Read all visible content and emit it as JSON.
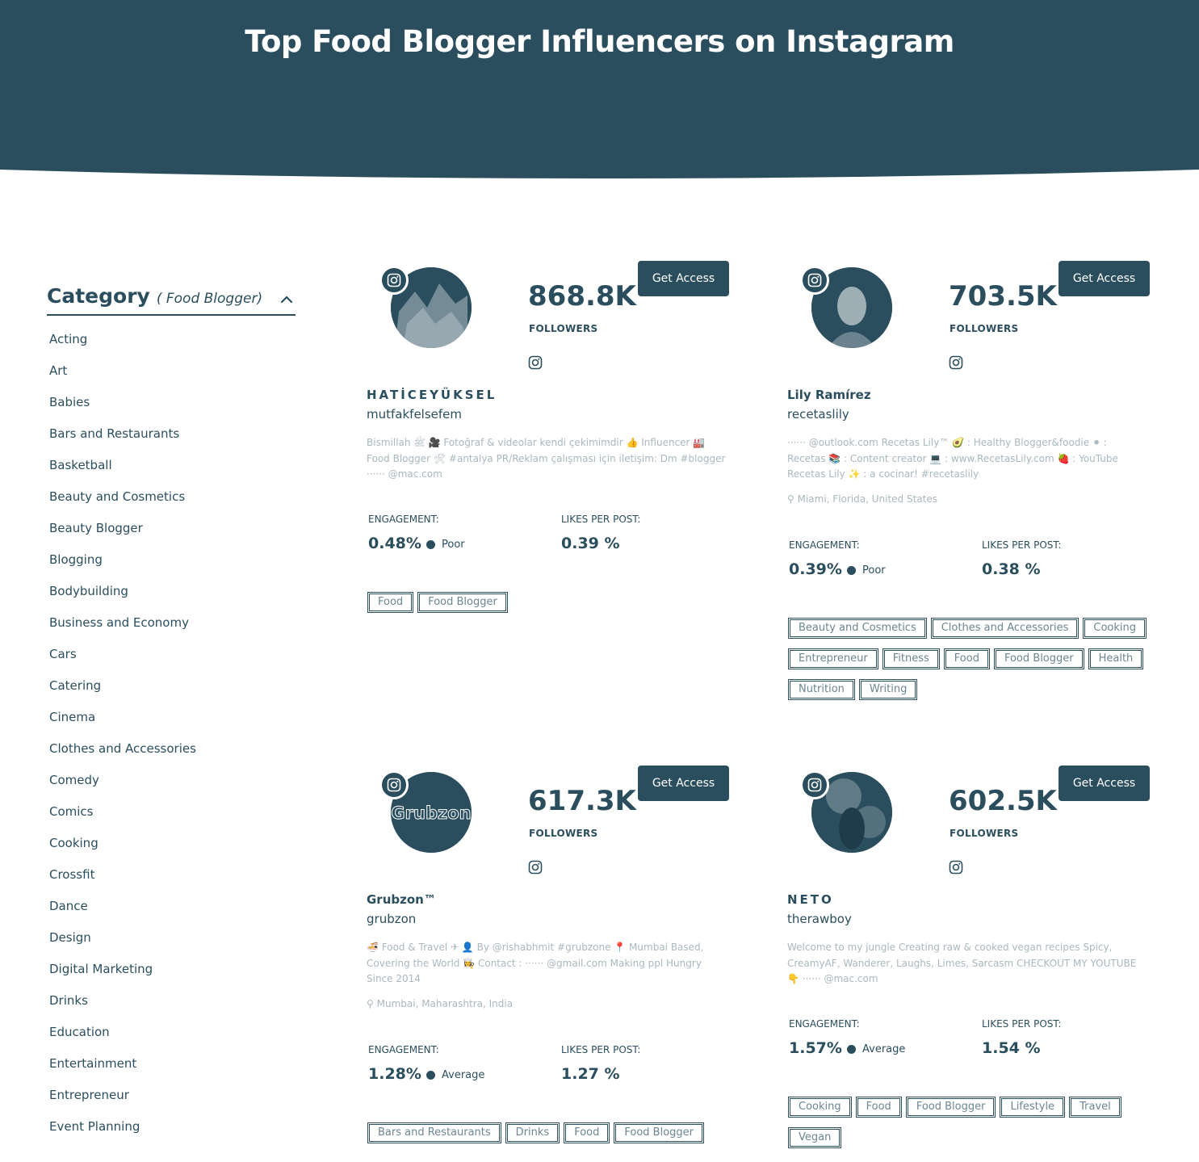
{
  "page": {
    "title": "Top Food Blogger Influencers on Instagram"
  },
  "colors": {
    "primary": "#2b4e5e",
    "muted_text": "#a9b8bf",
    "background": "#ffffff"
  },
  "sidebar": {
    "title": "Category",
    "subtitle": "( Food Blogger)",
    "toggle_icon": "chevron-up-icon",
    "items": [
      "Acting",
      "Art",
      "Babies",
      "Bars and Restaurants",
      "Basketball",
      "Beauty and Cosmetics",
      "Beauty Blogger",
      "Blogging",
      "Bodybuilding",
      "Business and Economy",
      "Cars",
      "Catering",
      "Cinema",
      "Clothes and Accessories",
      "Comedy",
      "Comics",
      "Cooking",
      "Crossfit",
      "Dance",
      "Design",
      "Digital Marketing",
      "Drinks",
      "Education",
      "Entertainment",
      "Entrepreneur",
      "Event Planning"
    ]
  },
  "labels": {
    "followers": "FOLLOWERS",
    "engagement": "ENGAGEMENT:",
    "likes_per_post": "LIKES PER POST:",
    "get_access": "Get Access"
  },
  "cards": [
    {
      "name": "HATİCEYÜKSEL",
      "handle": "mutfakfelsefem",
      "followers": "868.8K",
      "bio": "Bismillah ﷺ 🎥 Fotoğraf & videolar kendi çekimimdir 👍 Influencer 🏭 Food Blogger 🛠 #antalya PR/Reklam çalışması için iletişim: Dm #blogger ······ @mac.com",
      "location": "",
      "engagement": "0.48%",
      "rating": "Poor",
      "likes_per_post": "0.39 %",
      "tags": [
        "Food",
        "Food Blogger"
      ]
    },
    {
      "name": "Lily Ramírez",
      "handle": "recetaslily",
      "followers": "703.5K",
      "bio": "······ @outlook.com Recetas Lily™ 🥑 : Healthy Blogger&foodie ⚫ : Recetas 📚 : Content creator 💻 : www.RecetasLily.com 🍓 : YouTube Recetas Lily ✨ : a cocinar! #recetaslily",
      "location": "Miami, Florida, United States",
      "engagement": "0.39%",
      "rating": "Poor",
      "likes_per_post": "0.38 %",
      "tags": [
        "Beauty and Cosmetics",
        "Clothes and Accessories",
        "Cooking",
        "Entrepreneur",
        "Fitness",
        "Food",
        "Food Blogger",
        "Health",
        "Nutrition",
        "Writing"
      ]
    },
    {
      "name": "Grubzon™",
      "handle": "grubzon",
      "followers": "617.3K",
      "bio": "🍜 Food & Travel ✈ 👤 By @rishabhmit #grubzone 📍 Mumbai Based, Covering the World 👩‍🍳 Contact : ······ @gmail.com Making ppl Hungry Since 2014",
      "location": "Mumbai, Maharashtra, India",
      "engagement": "1.28%",
      "rating": "Average",
      "likes_per_post": "1.27 %",
      "tags": [
        "Bars and Restaurants",
        "Drinks",
        "Food",
        "Food Blogger"
      ]
    },
    {
      "name": "NETO",
      "handle": "therawboy",
      "followers": "602.5K",
      "bio": "Welcome to my jungle Creating raw & cooked vegan recipes Spicy, CreamyAF, Wanderer, Laughs, Limes, Sarcasm CHECKOUT MY YOUTUBE 👇 ······ @mac.com",
      "location": "",
      "engagement": "1.57%",
      "rating": "Average",
      "likes_per_post": "1.54 %",
      "tags": [
        "Cooking",
        "Food",
        "Food Blogger",
        "Lifestyle",
        "Travel",
        "Vegan"
      ]
    }
  ]
}
